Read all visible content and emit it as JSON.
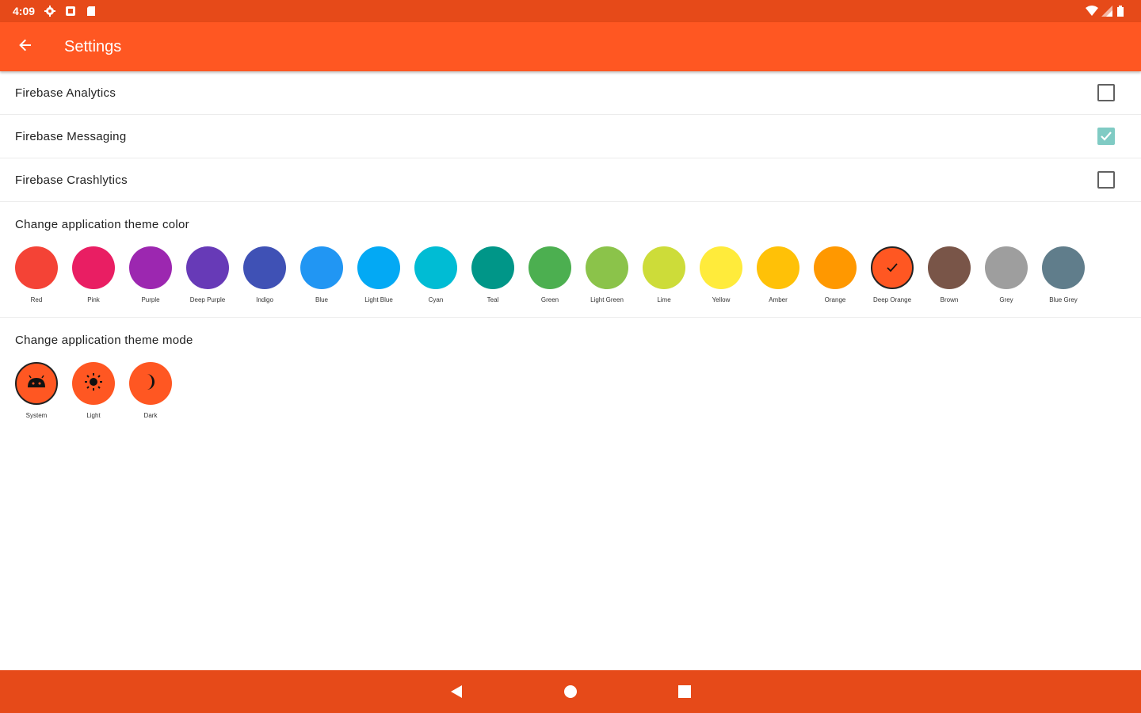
{
  "status_bar": {
    "time": "4:09",
    "icons": [
      "gear-icon",
      "notification-icon",
      "sd-card-icon",
      "wifi-icon",
      "signal-icon",
      "battery-icon"
    ]
  },
  "app_bar": {
    "title": "Settings",
    "back_icon": "arrow-back-icon"
  },
  "preferences": [
    {
      "label": "Firebase Analytics",
      "checked": false
    },
    {
      "label": "Firebase Messaging",
      "checked": true
    },
    {
      "label": "Firebase Crashlytics",
      "checked": false
    }
  ],
  "theme_color": {
    "title": "Change application theme color",
    "selected": "Deep Orange",
    "colors": [
      {
        "name": "Red",
        "hex": "#F44336"
      },
      {
        "name": "Pink",
        "hex": "#E91E63"
      },
      {
        "name": "Purple",
        "hex": "#9C27B0"
      },
      {
        "name": "Deep Purple",
        "hex": "#673AB7"
      },
      {
        "name": "Indigo",
        "hex": "#3F51B5"
      },
      {
        "name": "Blue",
        "hex": "#2196F3"
      },
      {
        "name": "Light Blue",
        "hex": "#03A9F4"
      },
      {
        "name": "Cyan",
        "hex": "#00BCD4"
      },
      {
        "name": "Teal",
        "hex": "#009688"
      },
      {
        "name": "Green",
        "hex": "#4CAF50"
      },
      {
        "name": "Light Green",
        "hex": "#8BC34A"
      },
      {
        "name": "Lime",
        "hex": "#CDDC39"
      },
      {
        "name": "Yellow",
        "hex": "#FFEB3B"
      },
      {
        "name": "Amber",
        "hex": "#FFC107"
      },
      {
        "name": "Orange",
        "hex": "#FF9800"
      },
      {
        "name": "Deep Orange",
        "hex": "#FF5722"
      },
      {
        "name": "Brown",
        "hex": "#795548"
      },
      {
        "name": "Grey",
        "hex": "#9E9E9E"
      },
      {
        "name": "Blue Grey",
        "hex": "#607D8B"
      }
    ]
  },
  "theme_mode": {
    "title": "Change application theme mode",
    "selected": "System",
    "modes": [
      {
        "label": "System",
        "icon": "android-icon"
      },
      {
        "label": "Light",
        "icon": "sun-icon"
      },
      {
        "label": "Dark",
        "icon": "moon-icon"
      }
    ]
  },
  "colors": {
    "primary": "#FF5722",
    "primary_dark": "#E64A19",
    "checkbox_checked": "#80CBC4"
  },
  "nav_bar": {
    "icons": [
      "back-triangle-icon",
      "home-circle-icon",
      "recents-square-icon"
    ]
  }
}
